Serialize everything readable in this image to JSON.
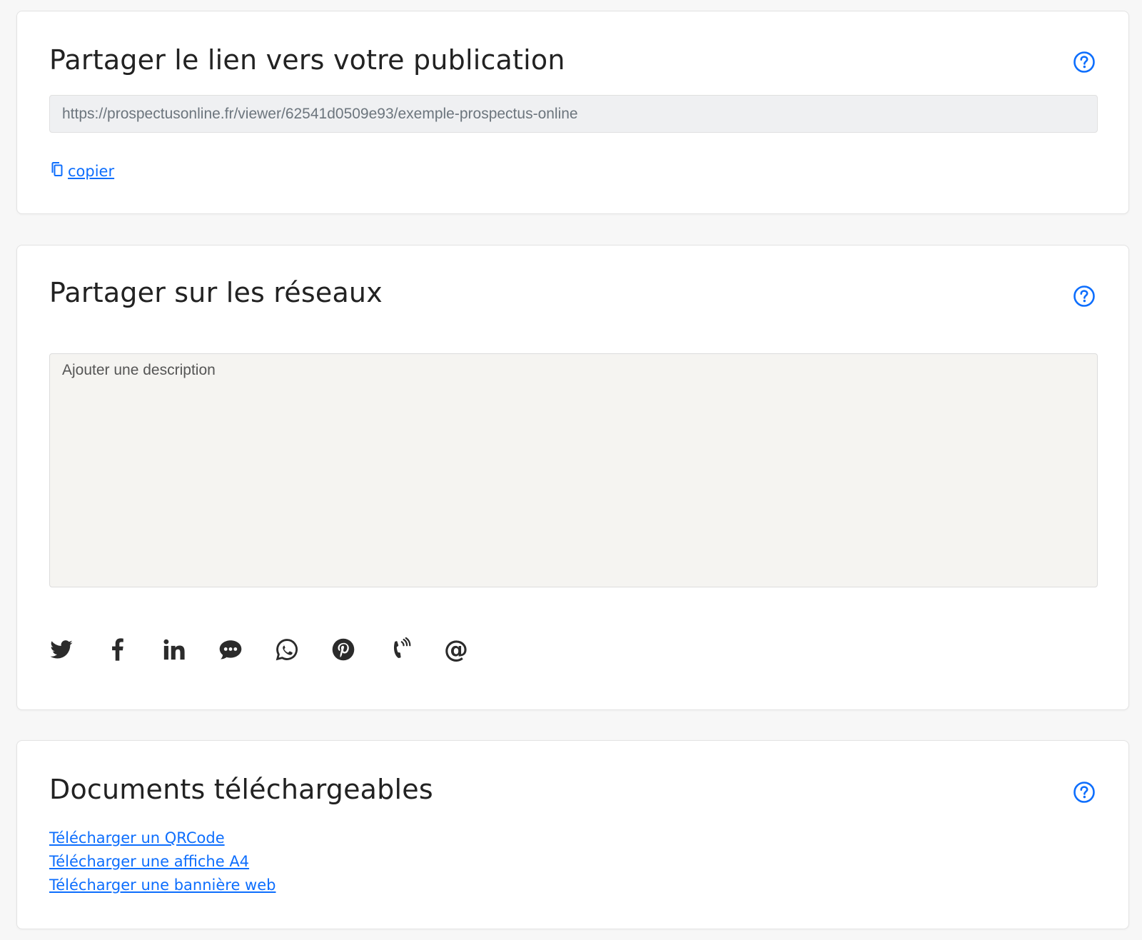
{
  "colors": {
    "accent": "#0d6efd",
    "icon": "#2b2b2b",
    "input_bg": "#eff0f2",
    "textarea_bg": "#f5f4f1"
  },
  "share_link": {
    "title": "Partager le lien vers votre publication",
    "url": "https://prospectusonline.fr/viewer/62541d0509e93/exemple-prospectus-online",
    "copy_label": "copier",
    "help_icon": "help-circle-icon"
  },
  "share_social": {
    "title": "Partager sur les réseaux",
    "description_placeholder": "Ajouter une description",
    "help_icon": "help-circle-icon",
    "networks": [
      "twitter-icon",
      "facebook-icon",
      "linkedin-icon",
      "sms-icon",
      "whatsapp-icon",
      "pinterest-icon",
      "call-icon",
      "email-icon"
    ]
  },
  "documents": {
    "title": "Documents téléchargeables",
    "help_icon": "help-circle-icon",
    "links": [
      "Télécharger un QRCode",
      "Télécharger une affiche A4",
      "Télécharger une bannière web"
    ]
  }
}
